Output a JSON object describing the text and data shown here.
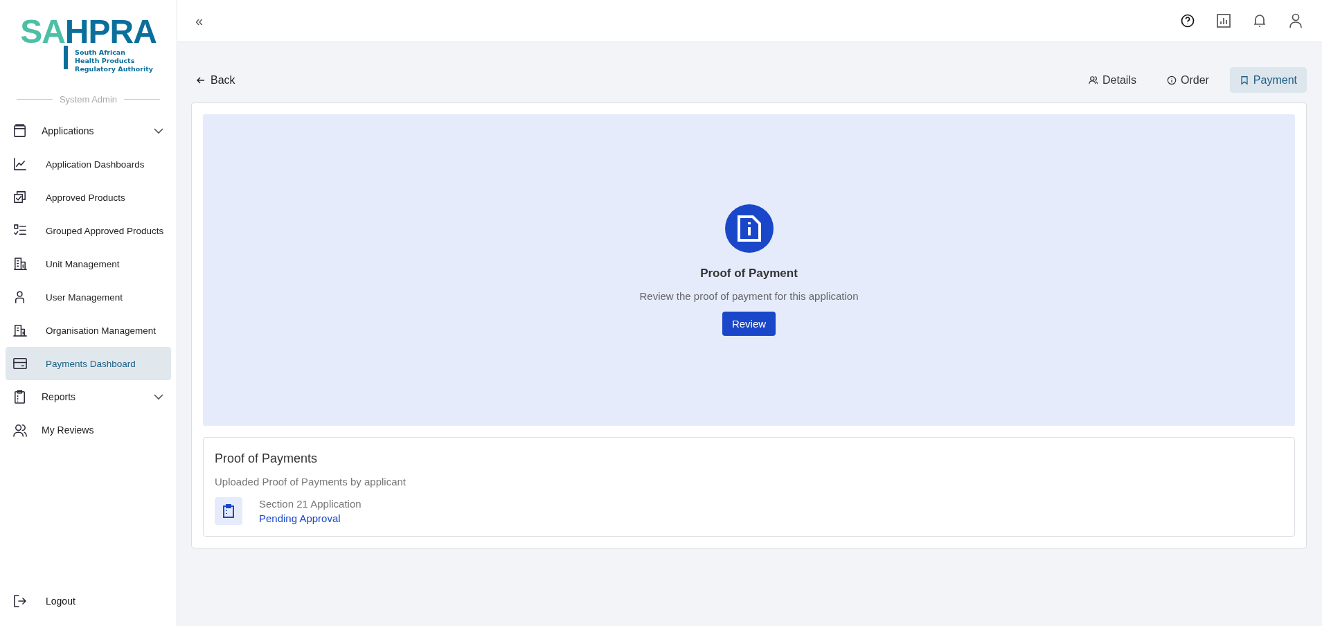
{
  "logo": {
    "lead": "SA",
    "rest": "HPRA",
    "tagline": [
      "South African",
      "Health Products",
      "Regulatory Authority"
    ]
  },
  "sidebar": {
    "role": "System Admin",
    "items": [
      {
        "label": "Applications",
        "kind": "group",
        "selected": false,
        "children": [
          {
            "label": "Application Dashboards",
            "selected": false
          },
          {
            "label": "Approved Products",
            "selected": false
          },
          {
            "label": "Grouped Approved Products",
            "selected": false
          },
          {
            "label": "Unit Management",
            "selected": false
          },
          {
            "label": "User Management",
            "selected": false
          },
          {
            "label": "Organisation Management",
            "selected": false
          },
          {
            "label": "Payments Dashboard",
            "selected": true
          }
        ]
      },
      {
        "label": "Reports",
        "kind": "group",
        "selected": false
      },
      {
        "label": "My Reviews",
        "kind": "link",
        "selected": false
      }
    ],
    "logout": "Logout"
  },
  "header": {
    "collapse": "«"
  },
  "back": "Back",
  "tabs": [
    {
      "label": "Details",
      "selected": false
    },
    {
      "label": "Order",
      "selected": false
    },
    {
      "label": "Payment",
      "selected": true
    }
  ],
  "hero": {
    "title": "Proof of Payment",
    "description": "Review the proof of payment for this application",
    "button": "Review"
  },
  "payments": {
    "title": "Proof of Payments",
    "subtitle": "Uploaded Proof of Payments by applicant",
    "items": [
      {
        "name": "Section 21 Application",
        "status": "Pending Approval"
      }
    ]
  }
}
